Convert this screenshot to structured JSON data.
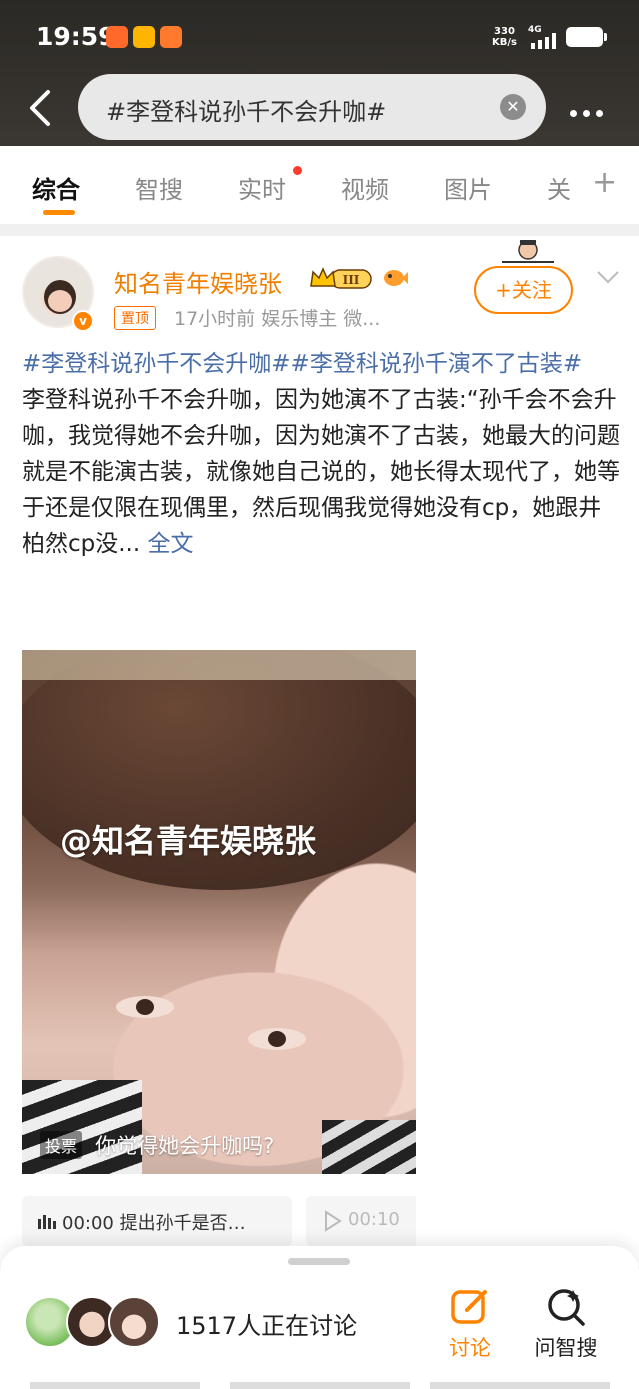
{
  "status_bar": {
    "time": "19:59",
    "net_speed_value": "330",
    "net_speed_unit": "KB/s",
    "network": "4G"
  },
  "search": {
    "query": "#李登科说孙千不会升咖#"
  },
  "tabs": [
    {
      "label": "综合",
      "active": true
    },
    {
      "label": "智搜"
    },
    {
      "label": "实时",
      "has_dot": true
    },
    {
      "label": "视频"
    },
    {
      "label": "图片"
    },
    {
      "label": "关"
    }
  ],
  "post": {
    "author": "知名青年娱晓张",
    "level_badge": "III",
    "pinned_label": "置顶",
    "meta": "17小时前  娱乐博主 微...",
    "follow_label": "+关注",
    "hashtags": "#李登科说孙千不会升咖##李登科说孙千演不了古装#",
    "text": "李登科说孙千不会升咖，因为她演不了古装:“孙千会不会升咖，我觉得她不会升咖，因为她演不了古装，她最大的问题就是不能演古装，就像她自己说的，她长得太现代了，她等于还是仅限在现偶里，然后现偶我觉得她没有cp，她跟井柏然cp没...",
    "full_text_link": "全文",
    "video_watermark": "@知名青年娱晓张",
    "vote_badge": "投票",
    "vote_question": "你觉得她会升咖吗?",
    "audio_1": "00:00 提出孙千是否…",
    "audio_2": "00:10"
  },
  "bottom_bar": {
    "discussion_count": "1517人正在讨论",
    "discuss_label": "讨论",
    "ask_label": "问智搜"
  },
  "colors": {
    "accent": "#ff8200",
    "hashtag": "#4a6ea8",
    "red_dot": "#ff3b30"
  }
}
